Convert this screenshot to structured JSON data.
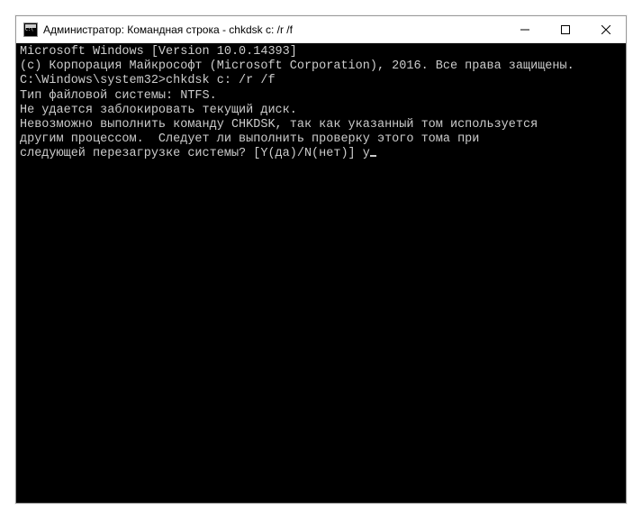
{
  "titlebar": {
    "text": "Администратор: Командная строка - chkdsk  c: /r /f"
  },
  "terminal": {
    "line1": "Microsoft Windows [Version 10.0.14393]",
    "line2": "(c) Корпорация Майкрософт (Microsoft Corporation), 2016. Все права защищены.",
    "blank1": "",
    "prompt_line": "C:\\Windows\\system32>chkdsk c: /r /f",
    "line3": "Тип файловой системы: NTFS.",
    "line4": "Не удается заблокировать текущий диск.",
    "blank2": "",
    "line5": "Невозможно выполнить команду CHKDSK, так как указанный том используется",
    "line6": "другим процессом.  Следует ли выполнить проверку этого тома при",
    "line7_prefix": "следующей перезагрузке системы? [Y(да)/N(нет)] ",
    "input": "y"
  }
}
